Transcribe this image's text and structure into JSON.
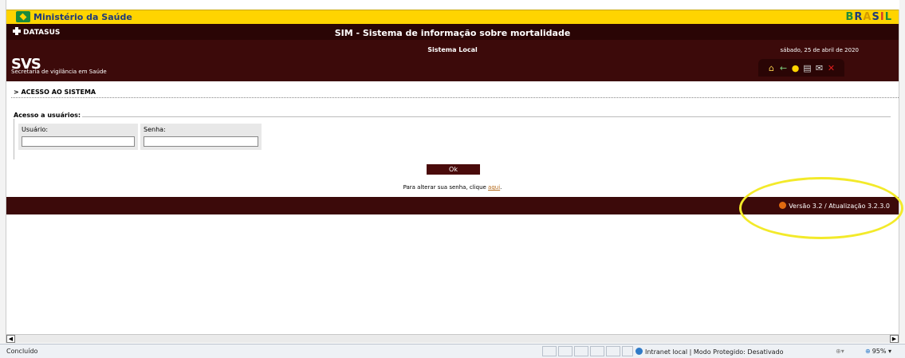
{
  "gov_bar": {
    "title": "Ministério da Saúde",
    "brasil_logo": "BRASIL"
  },
  "header": {
    "datasus": "DATASUS",
    "app_title": "SIM - Sistema de informação sobre mortalidade",
    "subsystem": "Sistema Local",
    "date": "sábado, 25 de abril de 2020",
    "svs_logo": "SVS",
    "svs_subtitle": "Secretaria de vigilância em Saúde",
    "toolbar": [
      {
        "name": "home-icon",
        "glyph": "⌂"
      },
      {
        "name": "back-arrow-icon",
        "glyph": "←"
      },
      {
        "name": "help-bulb-icon",
        "glyph": "♀"
      },
      {
        "name": "print-icon",
        "glyph": "⎙"
      },
      {
        "name": "mail-icon",
        "glyph": "✉"
      },
      {
        "name": "close-icon",
        "glyph": "✕"
      }
    ]
  },
  "main": {
    "section_title": "> ACESSO AO SISTEMA",
    "legend": "Acesso a usuários:",
    "usuario_label": "Usuário:",
    "usuario_value": "",
    "senha_label": "Senha:",
    "senha_value": "",
    "ok_label": "Ok",
    "senha_msg_prefix": "Para alterar sua senha, clique ",
    "senha_msg_link": "aqui",
    "senha_msg_suffix": "."
  },
  "footer": {
    "version": "Versão 3.2 / Atualização 3.2.3.0"
  },
  "statusbar": {
    "status": "Concluído",
    "zone": "Intranet local | Modo Protegido: Desativado",
    "zoom": "95%"
  },
  "colors": {
    "gov_yellow": "#ffd400",
    "header_maroon": "#3c0a0a",
    "highlight": "#f3ea2a",
    "link": "#b56a1a"
  }
}
